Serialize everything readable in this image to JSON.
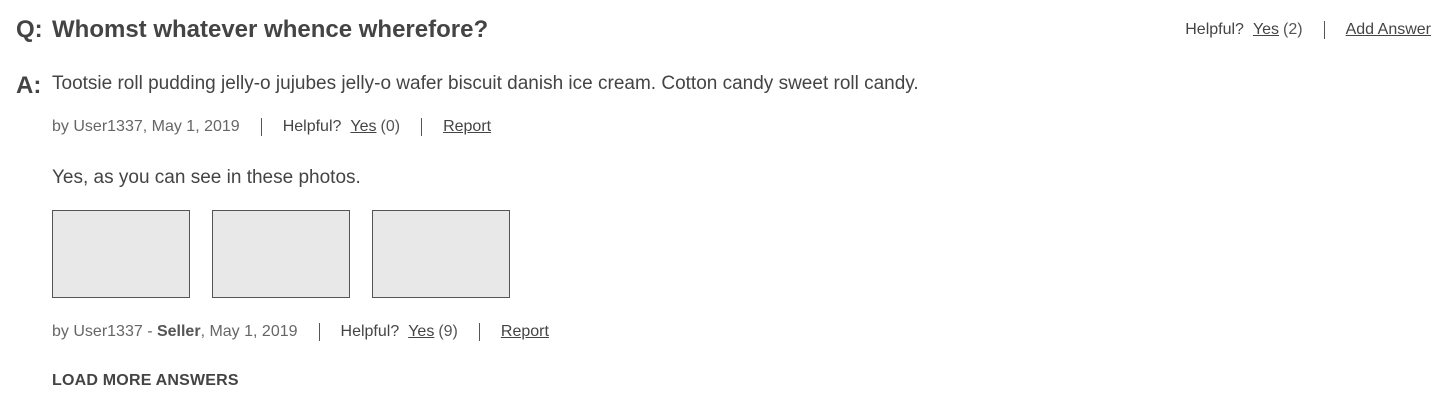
{
  "question": {
    "prefix": "Q:",
    "text": "Whomst whatever whence wherefore?",
    "helpful_label": "Helpful?",
    "yes_label": "Yes",
    "yes_count": "(2)",
    "add_answer_label": "Add Answer"
  },
  "answers": [
    {
      "prefix": "A:",
      "text": "Tootsie roll pudding jelly-o jujubes jelly-o wafer biscuit danish ice cream. Cotton candy sweet roll candy.",
      "by_prefix": "by",
      "author": "User1337",
      "date": "May 1, 2019",
      "helpful_label": "Helpful?",
      "yes_label": "Yes",
      "yes_count": "(0)",
      "report_label": "Report"
    },
    {
      "text": "Yes, as you can see in these photos.",
      "by_prefix": "by",
      "author": "User1337",
      "author_role_sep": "-",
      "author_role": "Seller",
      "date": "May 1, 2019",
      "helpful_label": "Helpful?",
      "yes_label": "Yes",
      "yes_count": "(9)",
      "report_label": "Report",
      "photo_count": 3
    }
  ],
  "load_more_label": "LOAD MORE ANSWERS"
}
